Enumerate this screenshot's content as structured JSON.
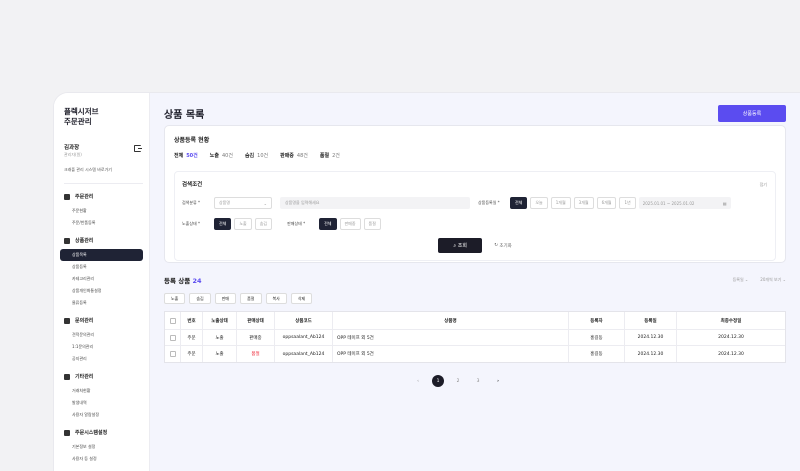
{
  "sidebar": {
    "brand_line1": "플렉시저브",
    "brand_line2": "주문관리",
    "user_name": "김과장",
    "user_sub": "관리자(원)",
    "system_link": "크래플 관리 시스템 바로가기",
    "groups": [
      {
        "label": "주문관리",
        "items": [
          "주문현황",
          "주문/반품등록"
        ]
      },
      {
        "label": "상품관리",
        "items": [
          "상품목록",
          "상품등록",
          "카테고리관리",
          "상품개인화통설정",
          "물류등록"
        ]
      },
      {
        "label": "문의관리",
        "items": [
          "견적문의관리",
          "1:1문의관리",
          "공지관리"
        ]
      },
      {
        "label": "기타관리",
        "items": [
          "거래처현황",
          "발생내역",
          "사용자 알람설정"
        ]
      },
      {
        "label": "주문시스템설정",
        "items": [
          "기본정보 설정",
          "사용자 등 설정"
        ]
      }
    ]
  },
  "header": {
    "title": "상품 목록",
    "register_button": "상품등록"
  },
  "status": {
    "title": "상품등록 현황",
    "items": [
      {
        "label": "전체",
        "value": "50건"
      },
      {
        "label": "노출",
        "value": "40건"
      },
      {
        "label": "숨김",
        "value": "10건"
      },
      {
        "label": "판매중",
        "value": "48건"
      },
      {
        "label": "품절",
        "value": "2건"
      }
    ]
  },
  "search": {
    "title": "검색조건",
    "fold": "접기",
    "search_type_label": "검색분류 *",
    "search_type_value": "상품명",
    "search_placeholder": "상품명을 입력해세요",
    "reg_date_label": "상품등록일 *",
    "date_ranges": [
      "전체",
      "오늘",
      "1개월",
      "3개월",
      "6개월",
      "1년"
    ],
    "date_value": "2025.01.01 ~ 2025.01.02",
    "visibility_label": "노출상태 *",
    "visibility_options": [
      "전체",
      "노출",
      "숨김"
    ],
    "sale_label": "판매상태 *",
    "sale_options": [
      "전체",
      "판매중",
      "품절"
    ],
    "search_button": "조회",
    "reset_button": "초기화"
  },
  "list": {
    "title": "등록 상품",
    "count": "24",
    "sort": "등록일",
    "per_page": "20개씩 보기",
    "actions": [
      "노출",
      "숨김",
      "판매",
      "품절",
      "복사",
      "삭제"
    ],
    "columns": [
      "번호",
      "노출상태",
      "판매상태",
      "상품코드",
      "상품명",
      "등록자",
      "등록일",
      "최종수정일"
    ],
    "rows": [
      [
        "주문",
        "노출",
        "판매중",
        "oppsaalant_Ab124",
        "OPP 테이프 외 5건",
        "홍길동",
        "2024.12.30",
        "2024.12.30"
      ],
      [
        "주문",
        "노출",
        "품절",
        "oppsaalant_Ab124",
        "OPP 테이프 외 5건",
        "홍길동",
        "2024.12.30",
        "2024.12.30"
      ]
    ]
  },
  "pagination": {
    "pages": [
      "1",
      "2",
      "3"
    ],
    "current": "1"
  },
  "colors": {
    "accent": "#5b4cf0",
    "dark": "#1c1c28",
    "soldout": "#e23"
  }
}
